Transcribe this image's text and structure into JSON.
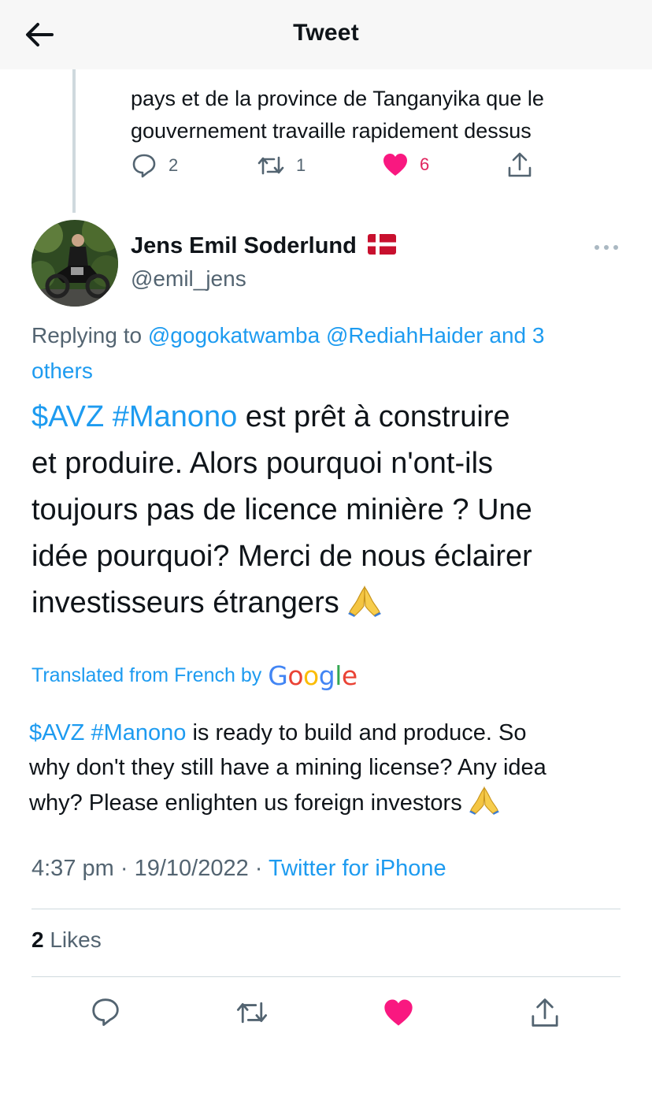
{
  "header": {
    "title": "Tweet"
  },
  "parent_tweet": {
    "text_lines": [
      "",
      "pays et de la province de Tanganyika que le",
      "gouvernement travaille rapidement dessus"
    ],
    "actions": {
      "replies": "2",
      "retweets": "1",
      "likes": "6",
      "liked": true
    }
  },
  "tweet": {
    "author": {
      "name": "Jens Emil Soderlund",
      "handle": "@emil_jens",
      "flag": "denmark-flag"
    },
    "replying": {
      "prefix": "Replying to ",
      "mention1": "@gogokatwamba",
      "mention2": "@RediahHaider",
      "others": " and 3",
      "others2": "others"
    },
    "text": {
      "line1_cashtag": "$AVZ",
      "line1_hashtag": "#Manono",
      "line1_rest": " est prêt à construire",
      "line2": "et produire.  Alors pourquoi n'ont-ils",
      "line3": "toujours pas de licence minière ?  Une",
      "line4": "idée pourquoi?  Merci de nous éclairer",
      "line5": "investisseurs étrangers "
    },
    "translation": {
      "label": "Translated from French by",
      "provider": "Google",
      "line1_cashtag": "$AVZ",
      "line1_hashtag": "#Manono",
      "line1_rest": " is ready to build and produce. So",
      "line2": "why don't they still have a mining license? Any idea",
      "line3": "why? Please enlighten us foreign investors "
    },
    "meta": {
      "time": "4:37 pm",
      "sep": " · ",
      "date": "19/10/2022",
      "sep2": " · ",
      "source": "Twitter for iPhone"
    },
    "stats": {
      "likes_count": "2",
      "likes_label": " Likes"
    },
    "emoji": "folded-hands-emoji"
  },
  "colors": {
    "accent": "#1d9bf0",
    "like": "#f91880",
    "text": "#0f1419",
    "muted": "#536471",
    "divider": "#cfd9de"
  },
  "icons": [
    "back-arrow-icon",
    "reply-icon",
    "retweet-icon",
    "heart-icon",
    "share-icon",
    "more-icon"
  ]
}
